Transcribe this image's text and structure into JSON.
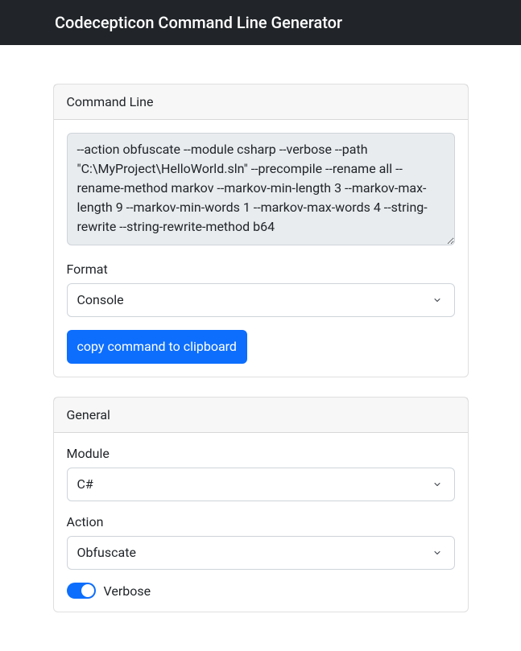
{
  "navbar": {
    "title": "Codecepticon Command Line Generator"
  },
  "commandLine": {
    "header": "Command Line",
    "output": "--action obfuscate --module csharp --verbose --path \"C:\\MyProject\\HelloWorld.sln\" --precompile --rename all --rename-method markov --markov-min-length 3 --markov-max-length 9 --markov-min-words 1 --markov-max-words 4 --string-rewrite --string-rewrite-method b64",
    "formatLabel": "Format",
    "formatValue": "Console",
    "copyButton": "copy command to clipboard"
  },
  "general": {
    "header": "General",
    "moduleLabel": "Module",
    "moduleValue": "C#",
    "actionLabel": "Action",
    "actionValue": "Obfuscate",
    "verboseLabel": "Verbose",
    "verboseChecked": true
  }
}
